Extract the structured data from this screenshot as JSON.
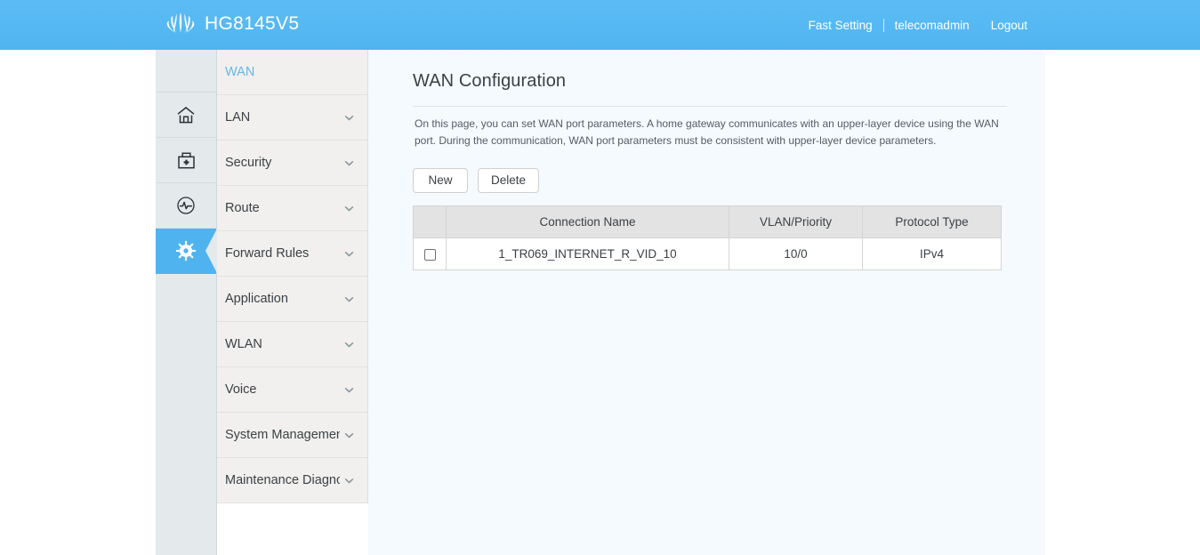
{
  "header": {
    "brand_name": "HG8145V5",
    "logo_icon": "huawei-flower-logo",
    "fast_setting": "Fast Setting",
    "username": "telecomadmin",
    "logout": "Logout"
  },
  "icon_rail": {
    "items": [
      {
        "icon": "home-icon",
        "active": false
      },
      {
        "icon": "toolbox-icon",
        "active": false
      },
      {
        "icon": "diagnostics-icon",
        "active": false
      },
      {
        "icon": "gear-icon",
        "active": true
      }
    ]
  },
  "menu": {
    "items": [
      {
        "label": "WAN",
        "selected": true,
        "expandable": false
      },
      {
        "label": "LAN",
        "selected": false,
        "expandable": true
      },
      {
        "label": "Security",
        "selected": false,
        "expandable": true
      },
      {
        "label": "Route",
        "selected": false,
        "expandable": true
      },
      {
        "label": "Forward Rules",
        "selected": false,
        "expandable": true
      },
      {
        "label": "Application",
        "selected": false,
        "expandable": true
      },
      {
        "label": "WLAN",
        "selected": false,
        "expandable": true
      },
      {
        "label": "Voice",
        "selected": false,
        "expandable": true
      },
      {
        "label": "System Management",
        "selected": false,
        "expandable": true
      },
      {
        "label": "Maintenance Diagno..",
        "selected": false,
        "expandable": true
      }
    ]
  },
  "content": {
    "title": "WAN Configuration",
    "description": "On this page, you can set WAN port parameters. A home gateway communicates with an upper-layer device using the WAN port. During the communication, WAN port parameters must be consistent with upper-layer device parameters.",
    "buttons": {
      "new": "New",
      "delete": "Delete"
    },
    "table": {
      "columns": [
        "",
        "Connection Name",
        "VLAN/Priority",
        "Protocol Type"
      ],
      "rows": [
        {
          "checked": false,
          "connection_name": "1_TR069_INTERNET_R_VID_10",
          "vlan_priority": "10/0",
          "protocol_type": "IPv4"
        }
      ]
    }
  },
  "colors": {
    "header_blue": "#4fb3ef",
    "accent_blue": "#64b6e8",
    "rail_bg": "#e4eaec",
    "menu_bg": "#f1f0ee",
    "content_bg": "#f5faff",
    "table_header_bg": "#e3e3e3"
  }
}
